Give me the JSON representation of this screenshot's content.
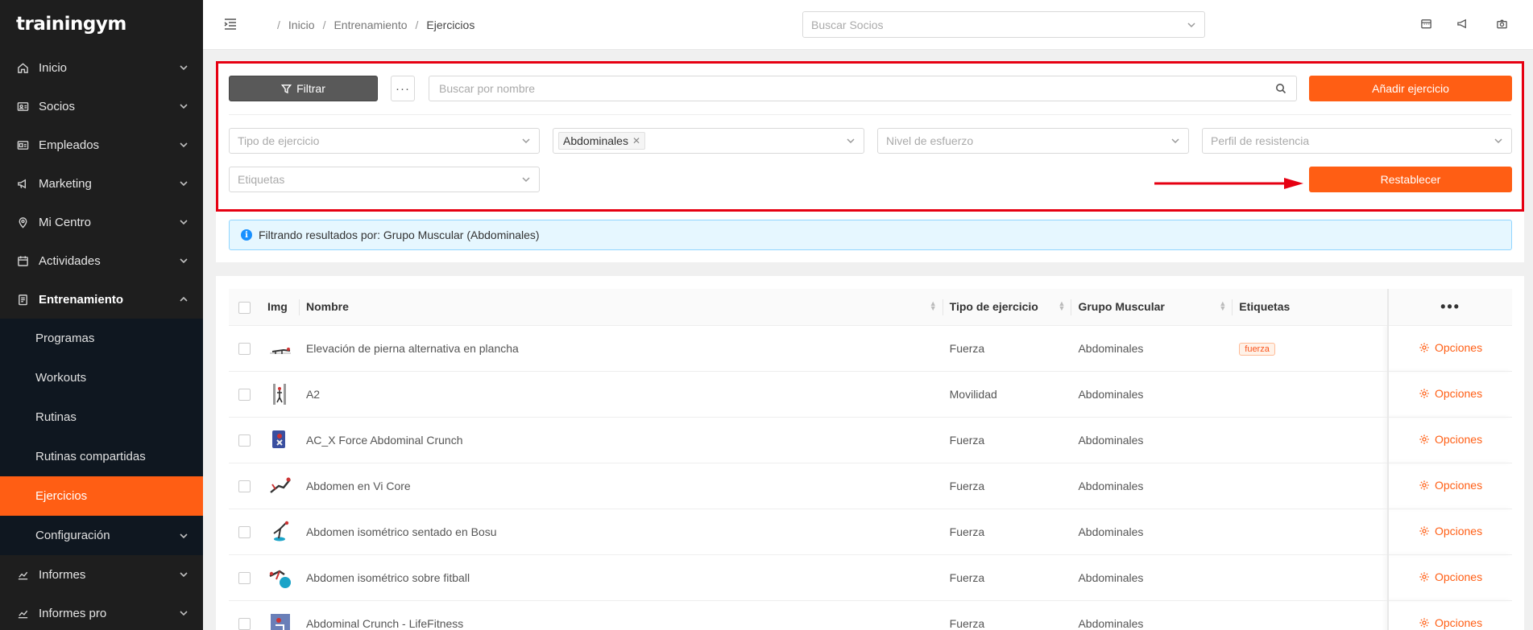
{
  "brand": "trainingym",
  "sidebar": {
    "items": [
      {
        "label": "Inicio",
        "icon": "home-icon"
      },
      {
        "label": "Socios",
        "icon": "id-card-icon"
      },
      {
        "label": "Empleados",
        "icon": "badge-icon"
      },
      {
        "label": "Marketing",
        "icon": "megaphone-icon"
      },
      {
        "label": "Mi Centro",
        "icon": "location-pin-icon"
      },
      {
        "label": "Actividades",
        "icon": "calendar-icon"
      },
      {
        "label": "Entrenamiento",
        "icon": "clipboard-icon"
      }
    ],
    "sub_items": [
      "Programas",
      "Workouts",
      "Rutinas",
      "Rutinas compartidas",
      "Ejercicios",
      "Configuración"
    ],
    "bottom_items": [
      {
        "label": "Informes",
        "icon": "chart-icon"
      },
      {
        "label": "Informes pro",
        "icon": "chart-icon"
      }
    ]
  },
  "topbar": {
    "breadcrumb": [
      "Inicio",
      "Entrenamiento",
      "Ejercicios"
    ],
    "member_search_placeholder": "Buscar Socios"
  },
  "filters": {
    "filter_button": "Filtrar",
    "more_button": "···",
    "name_search_placeholder": "Buscar por nombre",
    "add_button": "Añadir ejercicio",
    "tipo_placeholder": "Tipo de ejercicio",
    "grupo_selected": "Abdominales",
    "nivel_placeholder": "Nivel de esfuerzo",
    "perfil_placeholder": "Perfil de resistencia",
    "etiquetas_placeholder": "Etiquetas",
    "reset_button": "Restablecer"
  },
  "info": {
    "text": "Filtrando resultados por: Grupo Muscular (Abdominales)"
  },
  "table": {
    "headers": {
      "img": "Img",
      "nombre": "Nombre",
      "tipo": "Tipo de ejercicio",
      "grupo": "Grupo Muscular",
      "etiquetas": "Etiquetas",
      "more": "•••"
    },
    "options_label": "Opciones",
    "rows": [
      {
        "nombre": "Elevación de pierna alternativa en plancha",
        "tipo": "Fuerza",
        "grupo": "Abdominales",
        "etiqueta": "fuerza"
      },
      {
        "nombre": "A2",
        "tipo": "Movilidad",
        "grupo": "Abdominales",
        "etiqueta": ""
      },
      {
        "nombre": "AC_X Force Abdominal Crunch",
        "tipo": "Fuerza",
        "grupo": "Abdominales",
        "etiqueta": ""
      },
      {
        "nombre": "Abdomen en Vi Core",
        "tipo": "Fuerza",
        "grupo": "Abdominales",
        "etiqueta": ""
      },
      {
        "nombre": "Abdomen isométrico sentado en Bosu",
        "tipo": "Fuerza",
        "grupo": "Abdominales",
        "etiqueta": ""
      },
      {
        "nombre": "Abdomen isométrico sobre fitball",
        "tipo": "Fuerza",
        "grupo": "Abdominales",
        "etiqueta": ""
      },
      {
        "nombre": "Abdominal Crunch - LifeFitness",
        "tipo": "Fuerza",
        "grupo": "Abdominales",
        "etiqueta": ""
      }
    ]
  },
  "colors": {
    "accent": "#ff5e14",
    "sidebar_bg": "#1e1e1e",
    "submenu_bg": "#0f1720",
    "highlight": "#e60012"
  }
}
